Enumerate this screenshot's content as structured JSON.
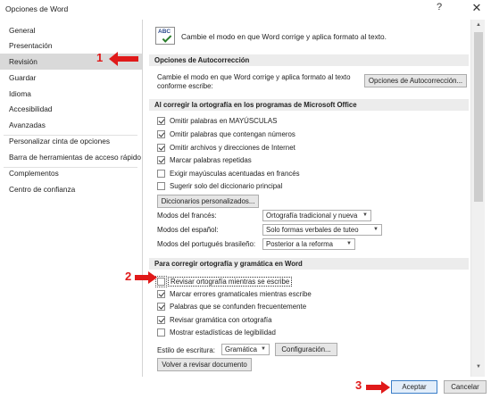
{
  "window": {
    "title": "Opciones de Word",
    "help_icon": "?",
    "close_icon": "✕"
  },
  "sidebar": {
    "items": [
      {
        "label": "General"
      },
      {
        "label": "Presentación"
      },
      {
        "label": "Revisión"
      },
      {
        "label": "Guardar"
      },
      {
        "label": "Idioma"
      },
      {
        "label": "Accesibilidad"
      },
      {
        "label": "Avanzadas"
      },
      {
        "label": "Personalizar cinta de opciones"
      },
      {
        "label": "Barra de herramientas de acceso rápido"
      },
      {
        "label": "Complementos"
      },
      {
        "label": "Centro de confianza"
      }
    ],
    "selected": "Revisión"
  },
  "header": {
    "icon_text": "ABC",
    "text": "Cambie el modo en que Word corrige y aplica formato al texto."
  },
  "autocorrect": {
    "heading": "Opciones de Autocorrección",
    "description_line1": "Cambie el modo en que Word corrige y aplica formato al texto",
    "description_line2": "conforme escribe:",
    "button": "Opciones de Autocorrección..."
  },
  "office_spelling": {
    "heading": "Al corregir la ortografía en los programas de Microsoft Office",
    "options": [
      {
        "label": "Omitir palabras en MAYÚSCULAS",
        "checked": true
      },
      {
        "label": "Omitir palabras que contengan números",
        "checked": true
      },
      {
        "label": "Omitir archivos y direcciones de Internet",
        "checked": true
      },
      {
        "label": "Marcar palabras repetidas",
        "checked": true
      },
      {
        "label": "Exigir mayúsculas acentuadas en francés",
        "checked": false
      },
      {
        "label": "Sugerir solo del diccionario principal",
        "checked": false
      }
    ],
    "dictionaries_button": "Diccionarios personalizados...",
    "modes": [
      {
        "label": "Modos del francés:",
        "value": "Ortografía tradicional y nueva"
      },
      {
        "label": "Modos del español:",
        "value": "Solo formas verbales de tuteo"
      },
      {
        "label": "Modos del portugués brasileño:",
        "value": "Posterior a la reforma"
      }
    ]
  },
  "word_spelling": {
    "heading": "Para corregir ortografía y gramática en Word",
    "options": [
      {
        "label": "Revisar ortografía mientras se escribe",
        "checked": false
      },
      {
        "label": "Marcar errores gramaticales mientras escribe",
        "checked": true
      },
      {
        "label": "Palabras que se confunden frecuentemente",
        "checked": true
      },
      {
        "label": "Revisar gramática con ortografía",
        "checked": true
      },
      {
        "label": "Mostrar estadísticas de legibilidad",
        "checked": false
      }
    ],
    "style_label": "Estilo de escritura:",
    "style_value": "Gramática",
    "config_button": "Configuración...",
    "recheck_button": "Volver a revisar documento"
  },
  "footer": {
    "accept": "Aceptar",
    "cancel": "Cancelar"
  },
  "annotations": {
    "marker1": "1",
    "marker2": "2",
    "marker3": "3",
    "color": "#e01a1a"
  }
}
